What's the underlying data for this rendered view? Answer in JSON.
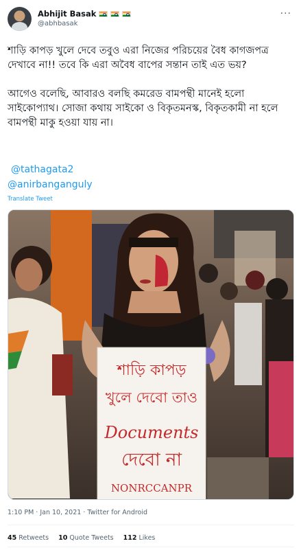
{
  "tweet": {
    "author": {
      "display_name": "Abhijit Basak",
      "handle": "@abhbasak"
    },
    "more_label": "···",
    "body": "শাড়ি কাপড় খুলে দেবে তবুও এরা নিজের পরিচয়ের বৈধ কাগজপত্র দেখাবে না!! তবে কি এরা অবৈধ বাপের সন্তান তাই এত ভয়?\n\nআগেও বলেছি, আবারও বলছি কমরেড বামপন্থী মানেই হলো সাইকোপ্যাথ। সোজা কথায় সাইকো ও বিকৃতমনস্ক, বিকৃতকামী না হলে বামপন্থী মাকু হওয়া যায় না।",
    "mentions": [
      "@tathagata2",
      "@anirbanganguly"
    ],
    "translate_label": "Translate Tweet",
    "photo_sign": {
      "line1": "শাড়ি কাপড়",
      "line2": "খুলে দেবো তাও",
      "line3": "Documents",
      "line4": "দেবো না",
      "line5": "NONRCCANPR"
    },
    "timestamp": "1:10 PM · Jan 10, 2021",
    "client": "Twitter for Android",
    "meta_line": "1:10 PM · Jan 10, 2021 · Twitter for Android",
    "stats": {
      "retweets_count": "45",
      "retweets_label": "Retweets",
      "quotes_count": "10",
      "quotes_label": "Quote Tweets",
      "likes_count": "112",
      "likes_label": "Likes"
    }
  },
  "colors": {
    "link": "#1d9bf0",
    "text": "#0f1419",
    "secondary": "#536471"
  }
}
